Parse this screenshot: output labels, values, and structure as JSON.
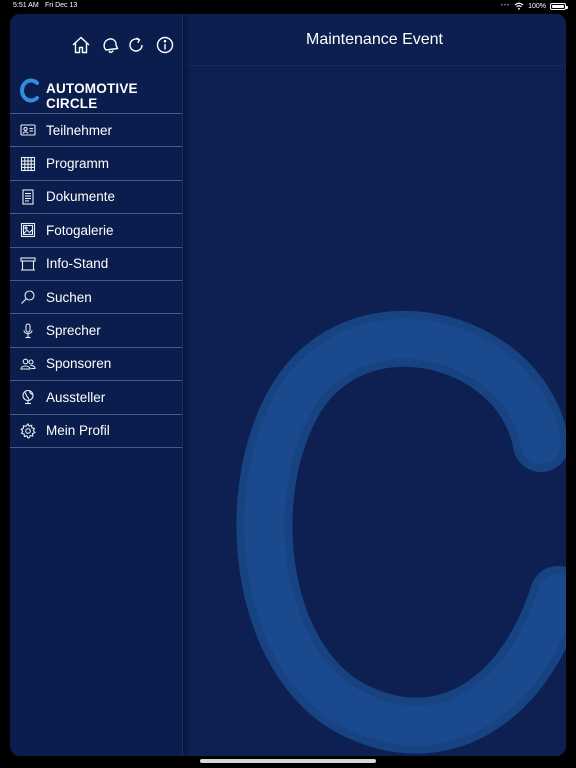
{
  "status_bar": {
    "time": "5:51 AM",
    "date": "Fri Dec 13",
    "battery": "100%"
  },
  "toolbar": {
    "icons": [
      "home-icon",
      "bell-icon",
      "refresh-icon",
      "info-icon"
    ]
  },
  "brand": {
    "name": "AUTOMOTIVE CIRCLE",
    "logo_color": "#2f8fe0"
  },
  "menu": {
    "items": [
      {
        "label": "Teilnehmer",
        "icon": "id-card-icon"
      },
      {
        "label": "Programm",
        "icon": "calendar-grid-icon"
      },
      {
        "label": "Dokumente",
        "icon": "document-icon"
      },
      {
        "label": "Fotogalerie",
        "icon": "photo-icon"
      },
      {
        "label": "Info-Stand",
        "icon": "booth-icon"
      },
      {
        "label": "Suchen",
        "icon": "search-icon"
      },
      {
        "label": "Sprecher",
        "icon": "microphone-icon"
      },
      {
        "label": "Sponsoren",
        "icon": "people-icon"
      },
      {
        "label": "Aussteller",
        "icon": "globe-icon"
      },
      {
        "label": "Mein Profil",
        "icon": "gear-icon"
      }
    ]
  },
  "main": {
    "title": "Maintenance Event"
  },
  "colors": {
    "background": "#0d2051",
    "sidebar": "#0a1d4c",
    "watermark": "#1b4a8c"
  }
}
